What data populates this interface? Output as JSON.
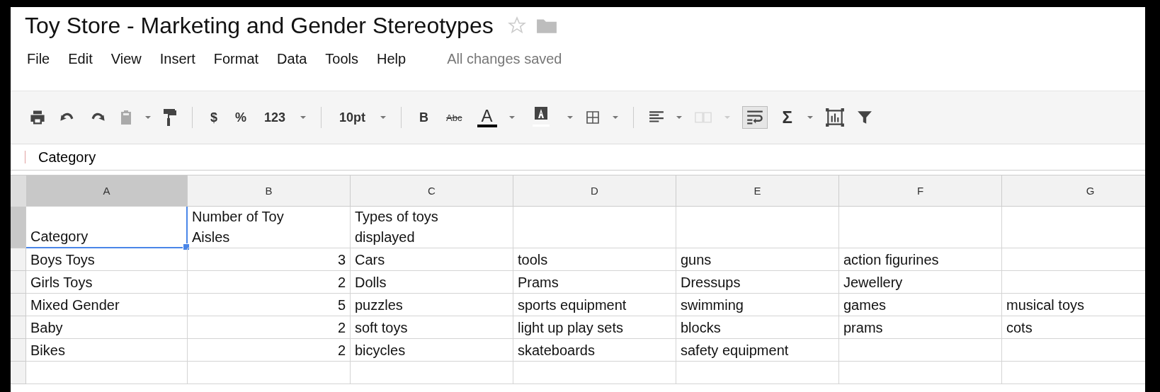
{
  "document": {
    "title": "Toy Store - Marketing and Gender Stereotypes",
    "starred": false
  },
  "menu": [
    "File",
    "Edit",
    "View",
    "Insert",
    "Format",
    "Data",
    "Tools",
    "Help"
  ],
  "save_status": "All changes saved",
  "toolbar": {
    "currency": "$",
    "percent": "%",
    "number_format": "123",
    "font_size": "10pt",
    "bold": "B",
    "strikethrough": "Abc",
    "text_color": "A",
    "sum": "Σ",
    "wrap_on": true
  },
  "formula_bar": {
    "value": "Category"
  },
  "columns": [
    {
      "label": "A",
      "selected": true
    },
    {
      "label": "B",
      "selected": false
    },
    {
      "label": "C",
      "selected": false
    },
    {
      "label": "D",
      "selected": false
    },
    {
      "label": "E",
      "selected": false
    },
    {
      "label": "F",
      "selected": false
    },
    {
      "label": "G",
      "selected": false
    }
  ],
  "rows": [
    {
      "selected": true,
      "cells": [
        {
          "text": "Category",
          "selected": true
        },
        {
          "text": "Number of Toy Aisles"
        },
        {
          "text": "Types of toys displayed"
        },
        null,
        null,
        null,
        null
      ]
    },
    {
      "selected": false,
      "cells": [
        {
          "text": "Boys Toys"
        },
        {
          "text": "3",
          "kind": "number"
        },
        {
          "text": "Cars"
        },
        {
          "text": "tools"
        },
        {
          "text": "guns"
        },
        {
          "text": "action figurines"
        },
        null
      ]
    },
    {
      "selected": false,
      "cells": [
        {
          "text": "Girls Toys"
        },
        {
          "text": "2",
          "kind": "number"
        },
        {
          "text": "Dolls"
        },
        {
          "text": "Prams"
        },
        {
          "text": "Dressups"
        },
        {
          "text": "Jewellery"
        },
        null
      ]
    },
    {
      "selected": false,
      "cells": [
        {
          "text": "Mixed Gender"
        },
        {
          "text": "5",
          "kind": "number"
        },
        {
          "text": "puzzles"
        },
        {
          "text": "sports equipment"
        },
        {
          "text": "swimming"
        },
        {
          "text": "games"
        },
        {
          "text": "musical toys"
        }
      ]
    },
    {
      "selected": false,
      "cells": [
        {
          "text": "Baby"
        },
        {
          "text": "2",
          "kind": "number"
        },
        {
          "text": "soft toys"
        },
        {
          "text": "light up play sets"
        },
        {
          "text": "blocks"
        },
        {
          "text": "prams"
        },
        {
          "text": "cots"
        }
      ]
    },
    {
      "selected": false,
      "cells": [
        {
          "text": "Bikes"
        },
        {
          "text": "2",
          "kind": "number"
        },
        {
          "text": "bicycles"
        },
        {
          "text": "skateboards"
        },
        {
          "text": "safety equipment"
        },
        null,
        null
      ]
    }
  ]
}
